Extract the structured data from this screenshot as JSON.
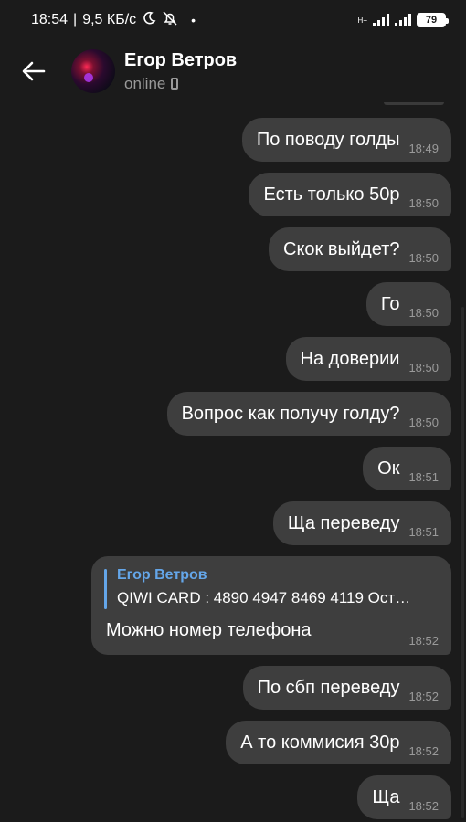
{
  "status_bar": {
    "time": "18:54",
    "speed": "9,5 КБ/с",
    "battery": "79",
    "network": "H+"
  },
  "header": {
    "name": "Егор Ветров",
    "status": "online"
  },
  "messages": [
    {
      "text": "По поводу голды",
      "time": "18:49"
    },
    {
      "text": "Есть только 50р",
      "time": "18:50"
    },
    {
      "text": "Скок выйдет?",
      "time": "18:50"
    },
    {
      "text": "Го",
      "time": "18:50"
    },
    {
      "text": "На доверии",
      "time": "18:50"
    },
    {
      "text": "Вопрос как получу голду?",
      "time": "18:50"
    },
    {
      "text": "Ок",
      "time": "18:51"
    },
    {
      "text": "Ща переведу",
      "time": "18:51"
    },
    {
      "text": "По сбп переведу",
      "time": "18:52"
    },
    {
      "text": "А то коммисия 30р",
      "time": "18:52"
    },
    {
      "text": "Ща",
      "time": "18:52"
    }
  ],
  "reply_message": {
    "quote_name": "Егор Ветров",
    "quote_text": "QIWI CARD : 4890 4947 8469 4119 Ост…",
    "text": "Можно номер телефона",
    "time": "18:52"
  },
  "colors": {
    "background": "#1b1b1b",
    "bubble": "#3e3e3e",
    "accent": "#64a6e9",
    "muted": "#9a9a9a"
  }
}
